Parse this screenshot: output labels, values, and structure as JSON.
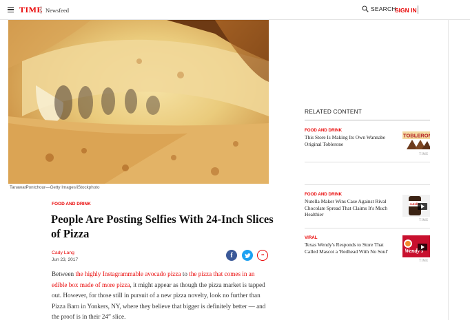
{
  "header": {
    "logo": "TIME",
    "section": "Newsfeed",
    "search_label": "SEARCH",
    "signin_label": "SIGN IN"
  },
  "hero": {
    "credit": "TanawatPontchour—Getty Images/iStockphoto"
  },
  "article": {
    "kicker": "FOOD AND DRINK",
    "headline": "People Are Posting Selfies With 24-Inch Slices of Pizza",
    "author": "Cady Lang",
    "date": "Jun 23, 2017",
    "share": {
      "facebook": "f",
      "twitter": "t",
      "more": "•••"
    },
    "body": {
      "p1": "Between ",
      "link1": "the highly Instagrammable avocado pizza",
      "p2": " to ",
      "link2": "the pizza that comes in an edible box made of more pizza",
      "p3": ", it might appear as though the pizza market is tapped out. However, for those still in pursuit of a new pizza novelty, look no further than Pizza Barn in Yonkers, NY, where they believe that bigger is definitely better — and the proof is in their 24” slice."
    }
  },
  "sidebar": {
    "title": "RELATED CONTENT",
    "items": [
      {
        "kicker": "FOOD AND DRINK",
        "title": "This Store Is Making Its Own Wannabe Original Toblerone",
        "source": "TIME",
        "thumb_text": "TOBLERON"
      },
      {
        "kicker": "FOOD AND DRINK",
        "title": "Nutella Maker Wins Case Against Rival Chocolate Spread That Claims It's Much Healthier",
        "source": "TIME",
        "thumb_text": "nutella"
      },
      {
        "kicker": "VIRAL",
        "title": "Texas Wendy's Responds to Store That Called Mascot a 'Redhead With No Soul'",
        "source": "TIME",
        "thumb_text": "Wendy's"
      }
    ]
  },
  "colors": {
    "brand_red": "#e90606",
    "facebook": "#3b5998",
    "twitter": "#1da1f2"
  }
}
